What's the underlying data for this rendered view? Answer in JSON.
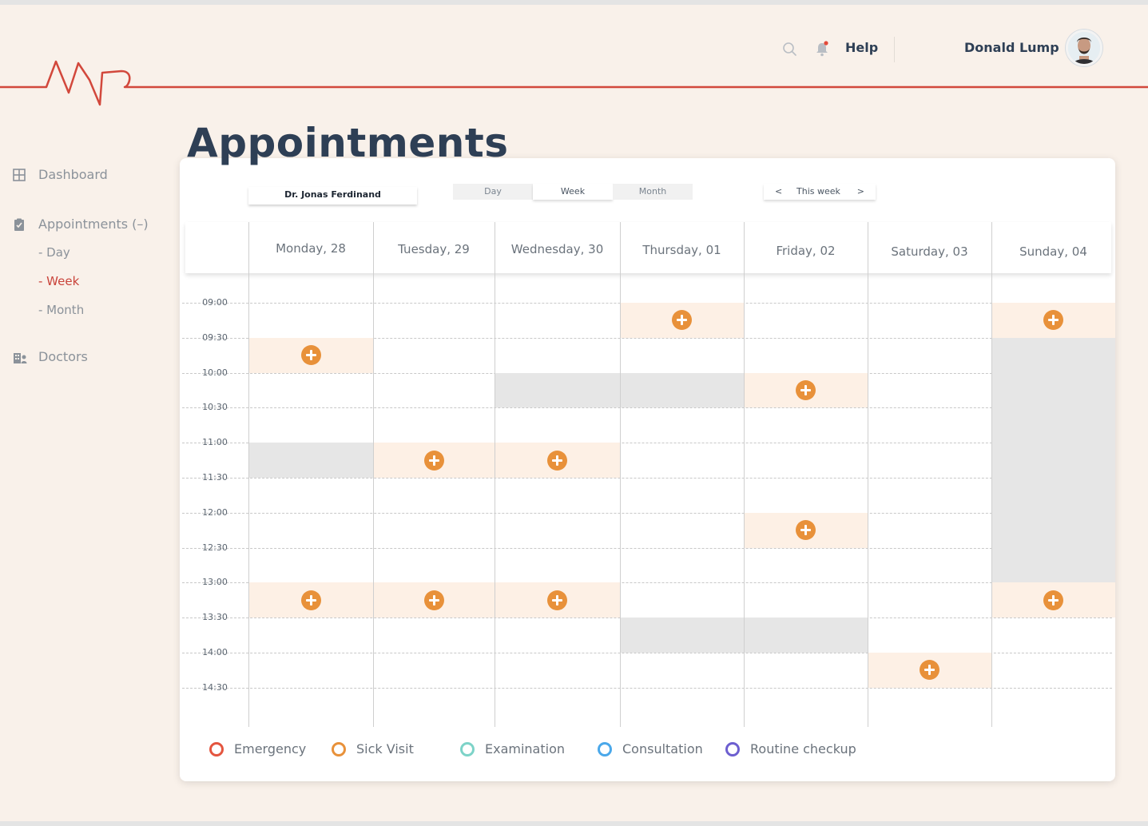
{
  "header": {
    "help_label": "Help",
    "user_name": "Donald Lump"
  },
  "colors": {
    "brand": "#c9433a",
    "accent": "#e8913a",
    "title": "#2e3f55",
    "background": "#f9f1ea"
  },
  "sidebar": {
    "items": [
      {
        "label": "Dashboard",
        "icon": "grid-icon"
      },
      {
        "label": "Appointments (–)",
        "icon": "clipboard-icon"
      },
      {
        "label": "- Day"
      },
      {
        "label": "- Week",
        "active": true
      },
      {
        "label": "- Month"
      },
      {
        "label": "Doctors",
        "icon": "doctors-icon"
      }
    ]
  },
  "page": {
    "title": "Appointments"
  },
  "toolbar": {
    "doctor": "Dr. Jonas Ferdinand",
    "views": [
      "Day",
      "Week",
      "Month"
    ],
    "active_view": "Week",
    "prev": "<",
    "period": "This week",
    "next": ">"
  },
  "calendar": {
    "days": [
      "Monday, 28",
      "Tuesday, 29",
      "Wednesday, 30",
      "Thursday, 01",
      "Friday, 02",
      "Saturday, 03",
      "Sunday, 04"
    ],
    "times": [
      "09:00",
      "09:30",
      "10:00",
      "10:30",
      "11:00",
      "11:30",
      "12:00",
      "12:30",
      "13:00",
      "13:30",
      "14:00",
      "14:30"
    ],
    "available_slots": [
      {
        "day": "Monday, 28",
        "time": "09:30"
      },
      {
        "day": "Monday, 28",
        "time": "13:00"
      },
      {
        "day": "Tuesday, 29",
        "time": "11:00"
      },
      {
        "day": "Tuesday, 29",
        "time": "13:00"
      },
      {
        "day": "Wednesday, 30",
        "time": "11:00"
      },
      {
        "day": "Wednesday, 30",
        "time": "13:00"
      },
      {
        "day": "Thursday, 01",
        "time": "09:00"
      },
      {
        "day": "Friday, 02",
        "time": "10:00"
      },
      {
        "day": "Friday, 02",
        "time": "12:00"
      },
      {
        "day": "Saturday, 03",
        "time": "14:00"
      },
      {
        "day": "Sunday, 04",
        "time": "09:00"
      },
      {
        "day": "Sunday, 04",
        "time": "13:00"
      }
    ],
    "blocked": [
      {
        "day": "Monday, 28",
        "from": "11:00",
        "to": "11:30"
      },
      {
        "day": "Wednesday, 30",
        "from": "10:00",
        "to": "10:30"
      },
      {
        "day": "Thursday, 01",
        "from": "10:00",
        "to": "10:30"
      },
      {
        "day": "Thursday, 01",
        "from": "13:30",
        "to": "14:00"
      },
      {
        "day": "Friday, 02",
        "from": "13:30",
        "to": "14:00"
      },
      {
        "day": "Sunday, 04",
        "from": "09:30",
        "to": "13:00"
      }
    ]
  },
  "legend": [
    {
      "label": "Emergency",
      "color": "#e4553f"
    },
    {
      "label": "Sick Visit",
      "color": "#e8913a"
    },
    {
      "label": "Examination",
      "color": "#7dd3c8"
    },
    {
      "label": "Consultation",
      "color": "#4aa8ea"
    },
    {
      "label": "Routine checkup",
      "color": "#6d5fd0"
    }
  ]
}
